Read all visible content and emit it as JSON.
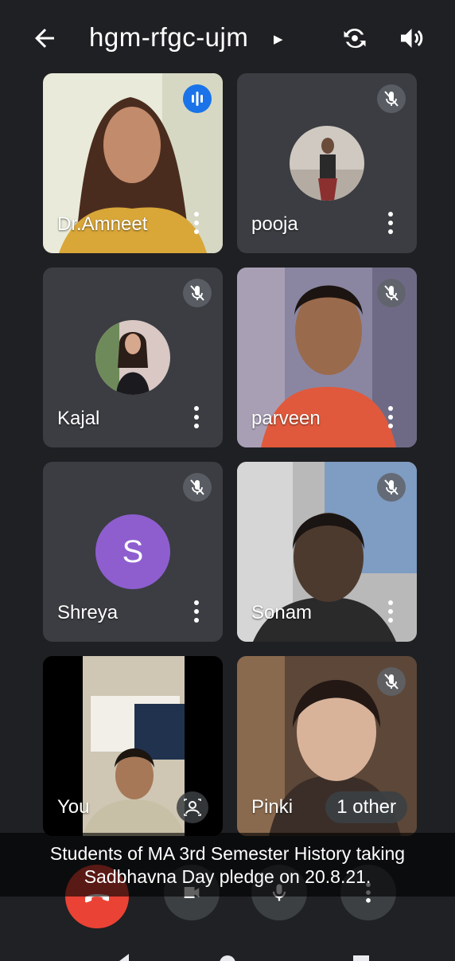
{
  "header": {
    "meeting_code": "hgm-rfgc-ujm"
  },
  "participants": [
    {
      "name": "Dr.Amneet",
      "speaking": true
    },
    {
      "name": "pooja",
      "muted": true
    },
    {
      "name": "Kajal",
      "muted": true
    },
    {
      "name": "parveen",
      "muted": true
    },
    {
      "name": "Shreya",
      "muted": true,
      "initial": "S"
    },
    {
      "name": "Sonam",
      "muted": true
    },
    {
      "name": "You"
    },
    {
      "name": "Pinki",
      "muted": true
    }
  ],
  "others_badge": "1 other",
  "caption": {
    "line1": "Students of MA 3rd Semester History taking",
    "line2": "Sadbhavna Day pledge on 20.8.21."
  },
  "colors": {
    "background": "#1f2023",
    "tile": "#3b3d42",
    "end_call": "#ea4335",
    "speaking": "#1a73e8",
    "avatar_s": "#8e5ecf"
  }
}
